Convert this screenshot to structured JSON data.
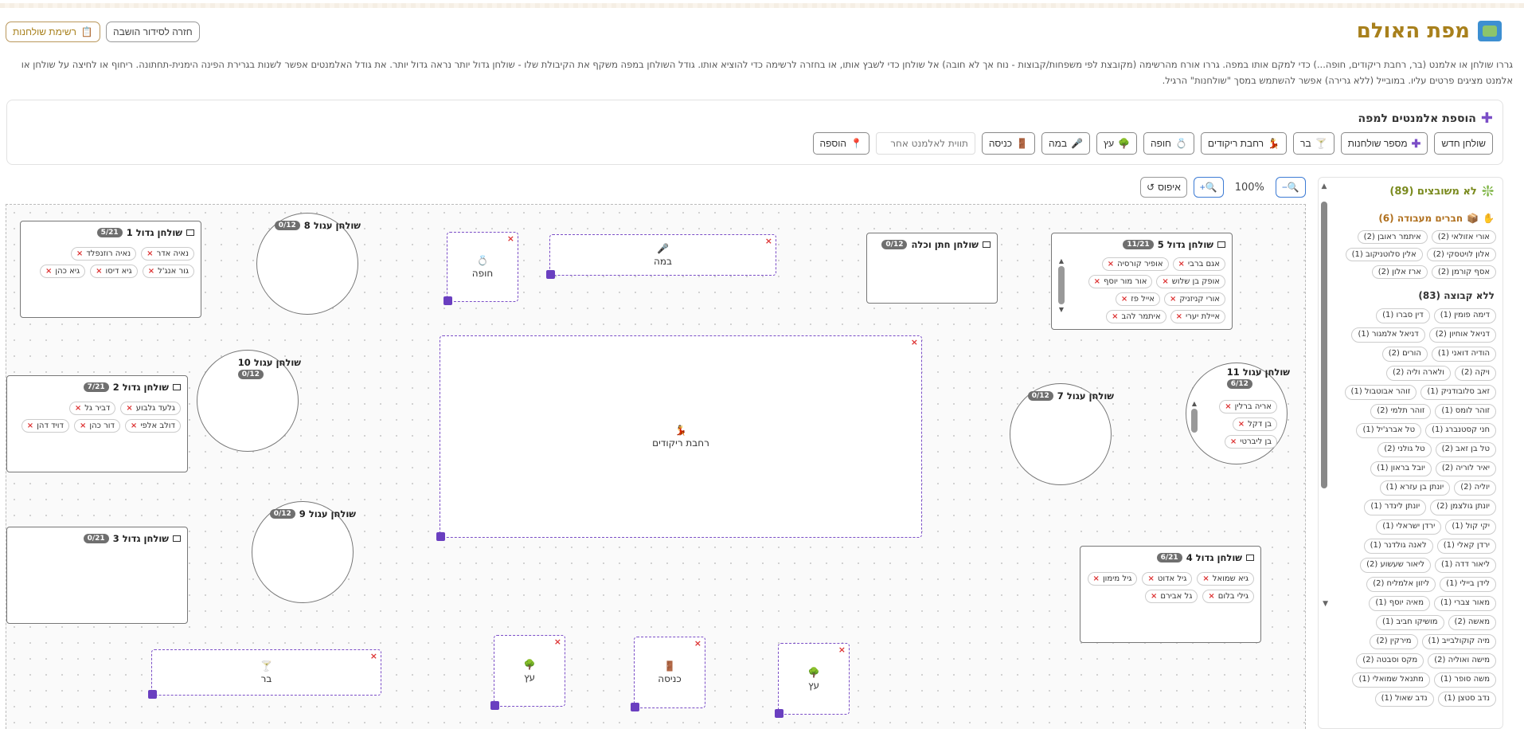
{
  "header": {
    "title": "מפת האולם",
    "back_button": "חזרה לסידור הושבה",
    "tables_button": "רשימת שולחנות",
    "description": "גררו שולחן או אלמנט (בר, רחבת ריקודים, חופה...) כדי למקם אותו במפה. גררו אורח מהרשימה (מקובצת לפי משפחות/קבוצות - נוח אך לא חובה) אל שולחן כדי לשבץ אותו, או בחזרה לרשימה כדי להוציא אותו. גודל השולחן במפה משקף את הקיבולת שלו - שולחן גדול יותר נראה גדול יותר. את גודל האלמנטים אפשר לשנות בגרירת הפינה הימנית-תחתונה. ריחוף או לחיצה על שולחן או אלמנט מציגים פרטים עליו. במובייל (ללא גרירה) אפשר להשתמש במסך \"שולחנות\" הרגיל."
  },
  "add_panel": {
    "title": "הוספת אלמנטים למפה",
    "buttons": [
      {
        "label": "שולחן חדש",
        "icon": "none"
      },
      {
        "label": "מספר שולחנות",
        "icon": "plus"
      },
      {
        "label": "בר",
        "icon": "🍸"
      },
      {
        "label": "רחבת ריקודים",
        "icon": "💃"
      },
      {
        "label": "חופה",
        "icon": "💍"
      },
      {
        "label": "עץ",
        "icon": "🌳"
      },
      {
        "label": "במה",
        "icon": "🎤"
      },
      {
        "label": "כניסה",
        "icon": "🚪"
      }
    ],
    "label_placeholder": "תווית לאלמנט אחר",
    "add_button": "הוספה",
    "add_icon": "📍"
  },
  "zoom": {
    "value": "100%",
    "reset_label": "איפוס"
  },
  "tables": {
    "big1": {
      "name": "שולחן גדול 1",
      "count": "5/21",
      "guests": [
        "נאיה אדר",
        "נאיה רוזנפלד",
        "גור אנג'ל",
        "גיא דיסו",
        "גיא כהן"
      ]
    },
    "round8": {
      "name": "שולחן עגול 8",
      "count": "0/12"
    },
    "big2": {
      "name": "שולחן גדול 2",
      "count": "7/21",
      "guests": [
        "גלעד גלבוע",
        "דביר גל",
        "דולב אלפי",
        "דור כהן",
        "דויד דהן"
      ]
    },
    "round10": {
      "name": "שולחן עגול 10",
      "count": "0/12"
    },
    "big3": {
      "name": "שולחן גדול 3",
      "count": "0/21"
    },
    "round9": {
      "name": "שולחן עגול 9",
      "count": "0/12"
    },
    "bride": {
      "name": "שולחן חתן וכלה",
      "count": "0/12"
    },
    "big5": {
      "name": "שולחן גדול 5",
      "count": "11/21",
      "guests": [
        "אגם ברבי",
        "אופיר קורסיה",
        "אופק בן שלוש",
        "אור מור יוסף",
        "אורי קניזניק",
        "אייל פז",
        "איילת יערי",
        "איתמר להב"
      ]
    },
    "round7": {
      "name": "שולחן עגול 7",
      "count": "0/12"
    },
    "round11": {
      "name": "שולחן עגול 11",
      "count": "6/12",
      "guests": [
        "אריה ברלין",
        "בן דקל",
        "בן ליברטי"
      ]
    },
    "big4": {
      "name": "שולחן גדול 4",
      "count": "6/21",
      "guests": [
        "גיא שמואל",
        "גיל אדוט",
        "גיל מימון",
        "גילי בלום",
        "גל אבירם"
      ]
    }
  },
  "zones": {
    "chuppah": {
      "label": "חופה",
      "icon": "💍"
    },
    "stage": {
      "label": "במה",
      "icon": "🎤"
    },
    "dance": {
      "label": "רחבת ריקודים",
      "icon": "💃"
    },
    "bar": {
      "label": "בר",
      "icon": "🍸"
    },
    "tree1": {
      "label": "עץ",
      "icon": "🌳"
    },
    "entrance": {
      "label": "כניסה",
      "icon": "🚪"
    },
    "tree2": {
      "label": "עץ",
      "icon": "🌳"
    }
  },
  "unassigned": {
    "title": "לא משובצים (89)",
    "work_group": {
      "title": "חברים מעבודה (6)",
      "guests": [
        "אורי אזולאי (2)",
        "איתמר ראובן (2)",
        "אלון לויטסקי (2)",
        "אלין סלוטניקוב (1)",
        "אסף קורמן (2)",
        "ארז אלון (2)"
      ]
    },
    "no_group": {
      "title": "ללא קבוצה (83)",
      "guests": [
        "דימה פומין (1)",
        "דין סברו (1)",
        "דניאל אוחיון (2)",
        "דניאל אלמגור (1)",
        "הודיה דואני (1)",
        "הורים (2)",
        "ויקה (2)",
        "ולארה וליה (2)",
        "זאב סלובודניק (1)",
        "זוהר אבוטבול (1)",
        "זוהר לומס (1)",
        "זוהר תלמי (2)",
        "חני קסטנברג (1)",
        "טל אברג'יל (1)",
        "טל בן זאב (2)",
        "טל גולני (2)",
        "יאיר לוריה (2)",
        "יובל בראון (1)",
        "יוליה (2)",
        "יונתן בן עזרא (1)",
        "יונתן גולצמן (2)",
        "יונתן לינדר (1)",
        "יקי קול (1)",
        "ירדן ישראלי (1)",
        "ירדן קאלי (1)",
        "לאנה גולדנר (1)",
        "ליאור דדה (1)",
        "ליאור שעשוע (2)",
        "לידן ביילי (1)",
        "ליזון אלמליח (2)",
        "מאור צברי (1)",
        "מאיה יוסף (1)",
        "מאשה (2)",
        "מושיקו חביב (1)",
        "מיה קוקולבייב (1)",
        "מירקין (2)",
        "מישה ואוליה (2)",
        "מקס וסבטה (2)",
        "משה סופר (1)",
        "מתנאל שמואלי (1)",
        "נדב סטצן (1)",
        "נדב שאול (1)"
      ]
    }
  }
}
